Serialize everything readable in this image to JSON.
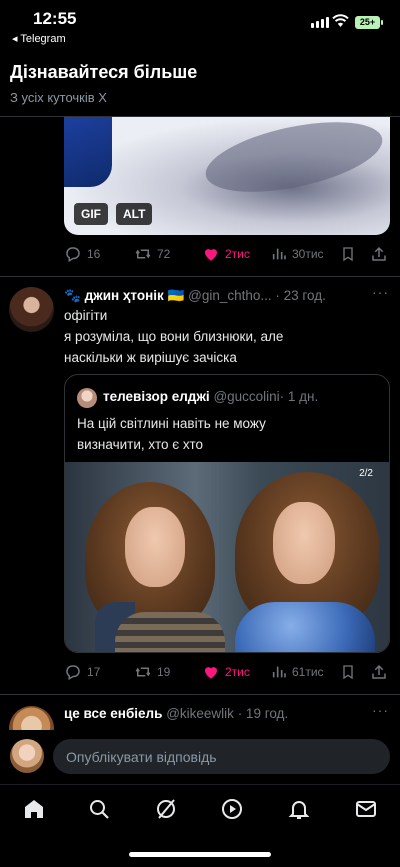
{
  "status": {
    "time": "12:55",
    "back_app": "◂ Telegram",
    "battery": "25+"
  },
  "header": {
    "title": "Дізнавайтеся більше",
    "subtitle": "З усіх куточків X"
  },
  "tweets": [
    {
      "media_tags": [
        "GIF",
        "ALT"
      ],
      "stats": {
        "replies": "16",
        "retweets": "72",
        "likes": "2тис",
        "views": "30тис"
      }
    },
    {
      "author_name": "джин ҳтонік",
      "author_emoji": "🐾",
      "flag": "🇺🇦",
      "handle": "@gin_chtho...",
      "time": "· 23 год.",
      "text_lines": [
        "офігіти",
        "я розуміла, що вони близнюки, але",
        "наскільки ж вирішує зачіска"
      ],
      "quote": {
        "author_name": "телевізор елджі",
        "handle": "@guccolini",
        "time": "· 1 дн.",
        "text_lines": [
          "На цій світлині навіть не можу",
          "визначити, хто є хто"
        ],
        "image_counter": "2/2"
      },
      "stats": {
        "replies": "17",
        "retweets": "19",
        "likes": "2тис",
        "views": "61тис"
      }
    },
    {
      "author_name": "це все енбіель",
      "handle": "@kikeewlik",
      "time": "· 19 год."
    }
  ],
  "reply": {
    "placeholder": "Опублікувати відповідь"
  },
  "nav": [
    "home-icon",
    "search-icon",
    "grok-icon",
    "play-icon",
    "bell-icon",
    "mail-icon"
  ],
  "colors": {
    "like": "#f91880",
    "muted": "#71767b",
    "bg": "#000000"
  }
}
